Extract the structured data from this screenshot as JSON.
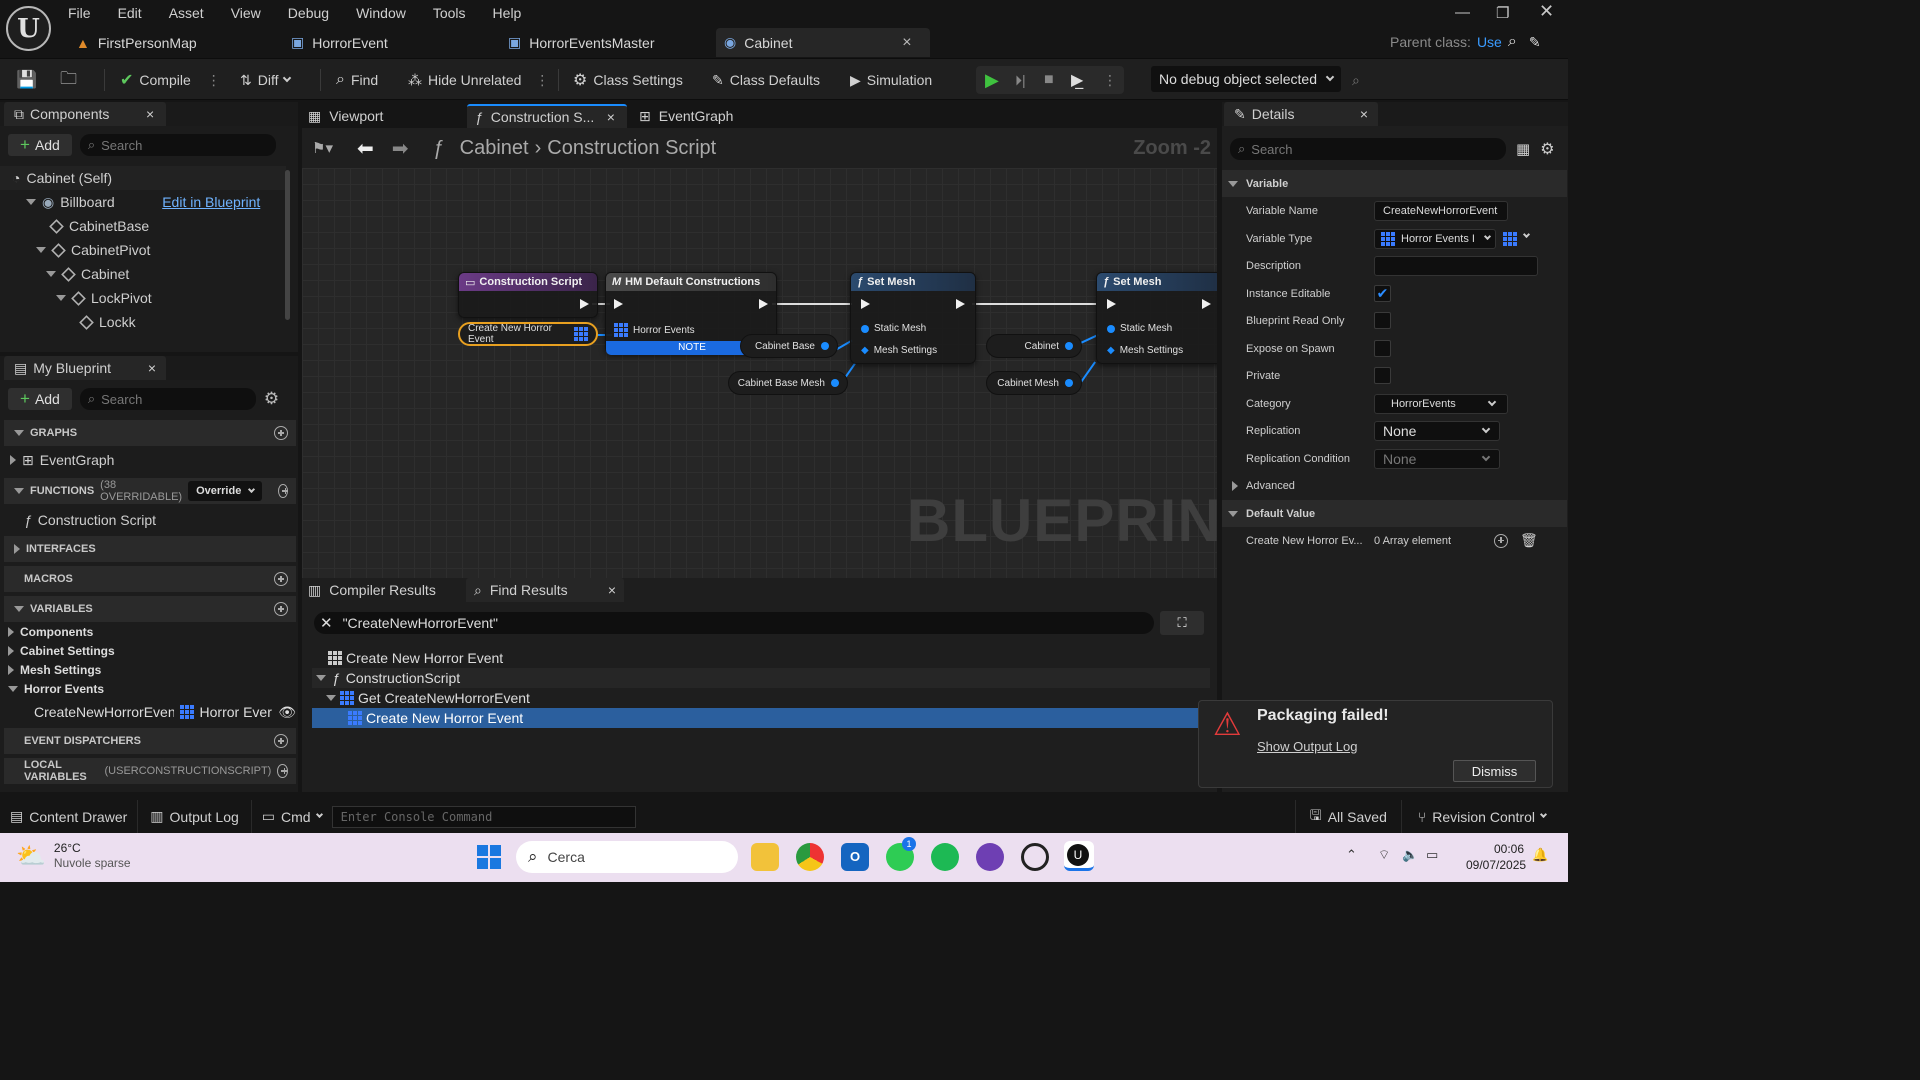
{
  "menu": [
    "File",
    "Edit",
    "Asset",
    "View",
    "Debug",
    "Window",
    "Tools",
    "Help"
  ],
  "doc_tabs": [
    {
      "label": "FirstPersonMap"
    },
    {
      "label": "HorrorEvent"
    },
    {
      "label": "HorrorEventsMaster"
    },
    {
      "label": "Cabinet",
      "close": "×"
    }
  ],
  "parent_class": {
    "label": "Parent class:",
    "value": "Use"
  },
  "toolbar": {
    "compile": "Compile",
    "diff": "Diff",
    "find": "Find",
    "hide_unrelated": "Hide Unrelated",
    "class_settings": "Class Settings",
    "class_defaults": "Class Defaults",
    "simulation": "Simulation",
    "debug_object": "No debug object selected"
  },
  "components": {
    "title": "Components",
    "close": "×",
    "add": "Add",
    "search_placeholder": "Search",
    "items": [
      {
        "label": "Cabinet (Self)"
      },
      {
        "label": "Billboard",
        "action": "Edit in Blueprint"
      },
      {
        "label": "CabinetBase"
      },
      {
        "label": "CabinetPivot"
      },
      {
        "label": "Cabinet"
      },
      {
        "label": "LockPivot"
      },
      {
        "label": "Lockk"
      }
    ]
  },
  "my_blueprint": {
    "title": "My Blueprint",
    "close": "×",
    "add": "Add",
    "search_placeholder": "Search",
    "graphs_hdr": "GRAPHS",
    "event_graph": "EventGraph",
    "functions_hdr": "FUNCTIONS",
    "functions_sub": "(38 OVERRIDABLE)",
    "override": "Override",
    "construction_script": "Construction Script",
    "interfaces_hdr": "INTERFACES",
    "macros_hdr": "MACROS",
    "variables_hdr": "VARIABLES",
    "var_groups": [
      "Components",
      "Cabinet Settings",
      "Mesh Settings",
      "Horror Events"
    ],
    "var_item": {
      "name": "CreateNewHorrorEven",
      "type": "Horror Ever"
    },
    "dispatchers_hdr": "EVENT DISPATCHERS",
    "local_hdr": "LOCAL VARIABLES",
    "local_sub": "(USERCONSTRUCTIONSCRIPT)"
  },
  "editor_tabs": {
    "viewport": "Viewport",
    "construction": "Construction S...",
    "close": "×",
    "event_graph": "EventGraph"
  },
  "breadcrumb": {
    "root": "Cabinet",
    "leaf": "Construction Script",
    "zoom": "Zoom -2"
  },
  "graph": {
    "watermark": "BLUEPRINT",
    "nodes": {
      "construction_script": "Construction Script",
      "create_var": "Create New Horror Event",
      "hm_default": "HM Default Constructions",
      "horror_events_pin": "Horror Events",
      "note": "NOTE",
      "cabinet_base": "Cabinet Base",
      "cabinet_base_mesh": "Cabinet Base Mesh",
      "set_mesh_1": "Set Mesh",
      "static_mesh": "Static Mesh",
      "mesh_settings": "Mesh Settings",
      "cabinet": "Cabinet",
      "cabinet_mesh": "Cabinet Mesh",
      "set_mesh_2": "Set Mesh"
    }
  },
  "results": {
    "compiler_tab": "Compiler Results",
    "find_tab": "Find Results",
    "close": "×",
    "query": "\"CreateNewHorrorEvent\"",
    "rows": [
      "Create New Horror Event",
      "ConstructionScript",
      "Get CreateNewHorrorEvent",
      "Create New Horror Event"
    ]
  },
  "details": {
    "title": "Details",
    "close": "×",
    "search_placeholder": "Search",
    "variable_hdr": "Variable",
    "variable_name_lbl": "Variable Name",
    "variable_name": "CreateNewHorrorEvent",
    "variable_type_lbl": "Variable Type",
    "variable_type": "Horror Events I",
    "description_lbl": "Description",
    "instance_editable_lbl": "Instance Editable",
    "bp_read_only_lbl": "Blueprint Read Only",
    "expose_spawn_lbl": "Expose on Spawn",
    "private_lbl": "Private",
    "category_lbl": "Category",
    "category": "HorrorEvents",
    "replication_lbl": "Replication",
    "replication": "None",
    "rep_cond_lbl": "Replication Condition",
    "rep_cond": "None",
    "advanced_hdr": "Advanced",
    "default_hdr": "Default Value",
    "default_lbl": "Create New Horror Ev...",
    "default_val": "0 Array element"
  },
  "toast": {
    "title": "Packaging failed!",
    "link": "Show Output Log",
    "dismiss": "Dismiss"
  },
  "statusbar": {
    "content_drawer": "Content Drawer",
    "output_log": "Output Log",
    "cmd": "Cmd",
    "console_placeholder": "Enter Console Command",
    "all_saved": "All Saved",
    "revision": "Revision Control"
  },
  "taskbar": {
    "temp": "26°C",
    "weather": "Nuvole sparse",
    "search": "Cerca",
    "time": "00:06",
    "date": "09/07/2025",
    "whatsapp_badge": "1"
  },
  "colors": {
    "accent": "#1a8cff",
    "node_purple": "#6b3b86",
    "node_blue": "#2b4a6e",
    "node_gray": "#4a4a4a",
    "selection": "#2b5f9e"
  }
}
